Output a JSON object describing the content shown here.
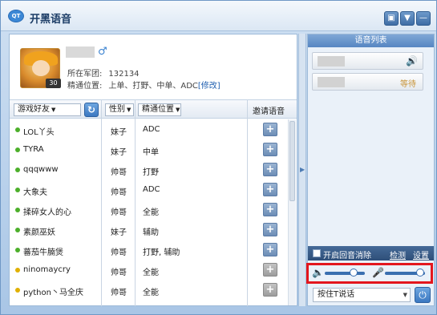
{
  "app": {
    "icon_label": "QT",
    "title": "开黑语音"
  },
  "profile": {
    "level": "30",
    "gender_icon": "male-icon",
    "legion_label": "所在军团:",
    "legion_value": "132134",
    "position_label": "精通位置:",
    "position_value": "上单、打野、中单、ADC",
    "edit_label": "[修改]"
  },
  "list_header": {
    "friends_dropdown": "游戏好友",
    "gender_dropdown": "性别",
    "position_dropdown": "精通位置",
    "invite_label": "邀请语音"
  },
  "friends": [
    {
      "name": "LOL丫头",
      "gender": "妹子",
      "position": "ADC",
      "status_color": "#4caf2a",
      "invite_enabled": true
    },
    {
      "name": "TYRA",
      "gender": "妹子",
      "position": "中单",
      "status_color": "#4caf2a",
      "invite_enabled": true
    },
    {
      "name": "qqqwww",
      "gender": "帅哥",
      "position": "打野",
      "status_color": "#4caf2a",
      "invite_enabled": true
    },
    {
      "name": "大象夫",
      "gender": "帅哥",
      "position": "ADC",
      "status_color": "#4caf2a",
      "invite_enabled": true
    },
    {
      "name": "揉碎女人的心",
      "gender": "帅哥",
      "position": "全能",
      "status_color": "#4caf2a",
      "invite_enabled": true
    },
    {
      "name": "素颜巫妖",
      "gender": "妹子",
      "position": "辅助",
      "status_color": "#4caf2a",
      "invite_enabled": true
    },
    {
      "name": "蕃茄牛腩煲",
      "gender": "帅哥",
      "position": "打野, 辅助",
      "status_color": "#4caf2a",
      "invite_enabled": true
    },
    {
      "name": "ninomaycry",
      "gender": "帅哥",
      "position": "全能",
      "status_color": "#e0b000",
      "invite_enabled": false
    },
    {
      "name": "python丶马全庆",
      "gender": "帅哥",
      "position": "全能",
      "status_color": "#e0b000",
      "invite_enabled": false
    }
  ],
  "voice_panel": {
    "header": "语音列表",
    "items": [
      {
        "status": "speaking",
        "speaker_icon": "speaker-icon"
      },
      {
        "status": "等待"
      }
    ],
    "echo_label": "开启回音消除",
    "detect_label": "检测",
    "settings_label": "设置",
    "speaker_volume": 0.72,
    "mic_volume": 0.88,
    "ptt_value": "按住T说话"
  }
}
